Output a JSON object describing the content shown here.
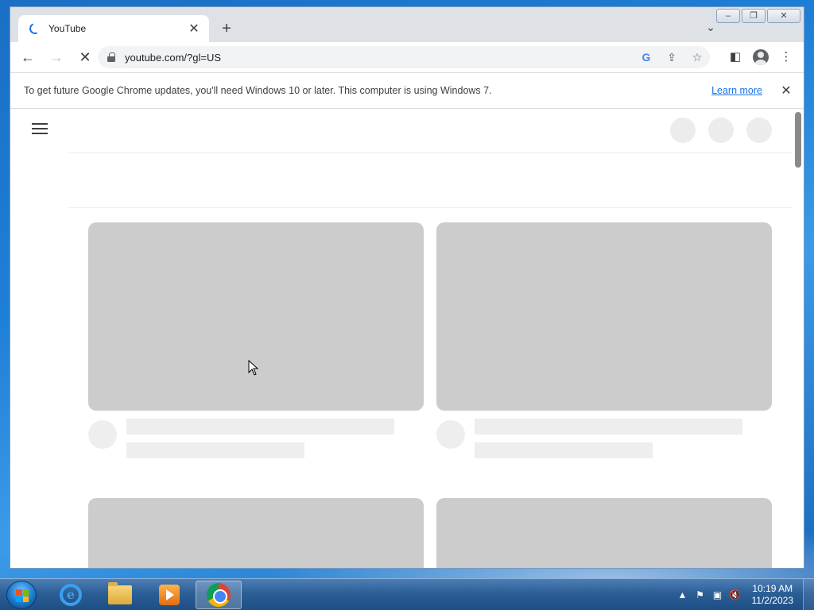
{
  "browser": {
    "tab": {
      "title": "YouTube"
    },
    "omnibox": {
      "url": "youtube.com/?gl=US"
    }
  },
  "infobar": {
    "message": "To get future Google Chrome updates, you'll need Windows 10 or later. This computer is using Windows 7.",
    "link": "Learn more"
  },
  "taskbar": {
    "clock": {
      "time": "10:19 AM",
      "date": "11/2/2023"
    }
  },
  "colors": {
    "link": "#1a73e8",
    "skeleton_thumb": "#cccccc",
    "skeleton_line": "#eeeeee"
  }
}
